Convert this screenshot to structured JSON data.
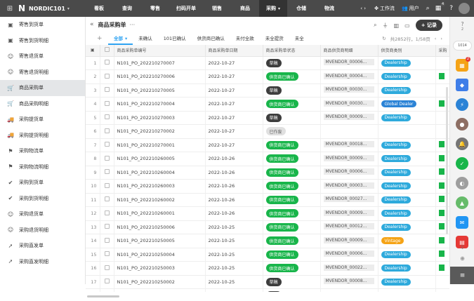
{
  "app": {
    "logo": "N",
    "brand": "NORDIC101"
  },
  "menu": [
    {
      "label": "看板",
      "width": 40
    },
    {
      "label": "查询",
      "width": 40
    },
    {
      "label": "零售",
      "width": 40
    },
    {
      "label": "扫码开单",
      "width": 48
    },
    {
      "label": "销售",
      "width": 40
    },
    {
      "label": "商品",
      "width": 40
    },
    {
      "label": "采购",
      "width": 40,
      "active": true,
      "caret": "▾"
    },
    {
      "label": "仓储",
      "width": 40
    },
    {
      "label": "物流",
      "width": 40
    }
  ],
  "topbar": {
    "nav_arrows": "‹ ›",
    "workflow": "工作流",
    "users": "用户",
    "notif_count": "4"
  },
  "sidebar": [
    {
      "icon": "▣",
      "label": "寄售到货单"
    },
    {
      "icon": "▣",
      "label": "寄售到货明细"
    },
    {
      "icon": "☺",
      "label": "寄售退货单"
    },
    {
      "icon": "☺",
      "label": "寄售退货明细"
    },
    {
      "icon": "🛒",
      "label": "商品采购单",
      "active": true
    },
    {
      "icon": "🛒",
      "label": "商品采购明细"
    },
    {
      "icon": "🚚",
      "label": "采购提货单"
    },
    {
      "icon": "🚚",
      "label": "采购提货明细"
    },
    {
      "icon": "⚑",
      "label": "采购物流单"
    },
    {
      "icon": "⚑",
      "label": "采购物流明细"
    },
    {
      "icon": "✔",
      "label": "采购到货单"
    },
    {
      "icon": "✔",
      "label": "采购到货明细"
    },
    {
      "icon": "☺",
      "label": "采购退货单"
    },
    {
      "icon": "☺",
      "label": "采购退货明细"
    },
    {
      "icon": "➚",
      "label": "采购直发单"
    },
    {
      "icon": "➚",
      "label": "采购直发明细"
    }
  ],
  "page": {
    "title": "商品采购单",
    "more": "···",
    "add_label": "+ 记录"
  },
  "tabs": [
    {
      "label": "全部",
      "active": true,
      "caret": "▾"
    },
    {
      "label": "未确认"
    },
    {
      "label": "101已确认"
    },
    {
      "label": "供货商已确认"
    },
    {
      "label": "未付全款"
    },
    {
      "label": "未全提货"
    },
    {
      "label": "未全"
    }
  ],
  "pagination": {
    "summary": "共2852行，1/58页"
  },
  "columns": [
    "商品采购单编号",
    "商品采购单日期",
    "商品采购单状态",
    "商品供货商明细",
    "供货商类别",
    "采购"
  ],
  "statuses": {
    "draft": "草稿",
    "confirmed": "供货商已确认",
    "void": "已作废"
  },
  "rows": [
    {
      "n": "1",
      "id": "N101_PO_202210270007",
      "date": "2022-10-27",
      "status": "draft",
      "vendor": "MVENDOR_00006...",
      "cat": "Dealership",
      "cat_type": "blue",
      "extra": false
    },
    {
      "n": "2",
      "id": "N101_PO_202210270006",
      "date": "2022-10-27",
      "status": "confirmed",
      "vendor": "MVENDOR_00004...",
      "cat": "Dealership",
      "cat_type": "blue",
      "extra": true
    },
    {
      "n": "3",
      "id": "N101_PO_202210270005",
      "date": "2022-10-27",
      "status": "draft",
      "vendor": "MVENDOR_00030...",
      "cat": "Dealership",
      "cat_type": "blue",
      "extra": false
    },
    {
      "n": "4",
      "id": "N101_PO_202210270004",
      "date": "2022-10-27",
      "status": "confirmed",
      "vendor": "MVENDOR_00030...",
      "cat": "Global Dealer",
      "cat_type": "gdel",
      "extra": true
    },
    {
      "n": "5",
      "id": "N101_PO_202210270003",
      "date": "2022-10-27",
      "status": "draft",
      "vendor": "MVENDOR_00009...",
      "cat": "Dealership",
      "cat_type": "blue",
      "extra": false
    },
    {
      "n": "6",
      "id": "N101_PO_202210270002",
      "date": "2022-10-27",
      "status": "void",
      "vendor": "",
      "cat": "",
      "cat_type": "",
      "extra": false
    },
    {
      "n": "7",
      "id": "N101_PO_202210270001",
      "date": "2022-10-27",
      "status": "confirmed",
      "vendor": "MVENDOR_00018...",
      "cat": "Dealership",
      "cat_type": "blue",
      "extra": true
    },
    {
      "n": "8",
      "id": "N101_PO_202210260005",
      "date": "2022-10-26",
      "status": "confirmed",
      "vendor": "MVENDOR_00009...",
      "cat": "Dealership",
      "cat_type": "blue",
      "extra": true
    },
    {
      "n": "9",
      "id": "N101_PO_202210260004",
      "date": "2022-10-26",
      "status": "confirmed",
      "vendor": "MVENDOR_00006...",
      "cat": "Dealership",
      "cat_type": "blue",
      "extra": true
    },
    {
      "n": "10",
      "id": "N101_PO_202210260003",
      "date": "2022-10-26",
      "status": "confirmed",
      "vendor": "MVENDOR_00003...",
      "cat": "Dealership",
      "cat_type": "blue",
      "extra": true
    },
    {
      "n": "11",
      "id": "N101_PO_202210260002",
      "date": "2022-10-26",
      "status": "confirmed",
      "vendor": "MVENDOR_00027...",
      "cat": "Dealership",
      "cat_type": "blue",
      "extra": true
    },
    {
      "n": "12",
      "id": "N101_PO_202210260001",
      "date": "2022-10-26",
      "status": "confirmed",
      "vendor": "MVENDOR_00009...",
      "cat": "Dealership",
      "cat_type": "blue",
      "extra": true
    },
    {
      "n": "13",
      "id": "N101_PO_202210250006",
      "date": "2022-10-25",
      "status": "confirmed",
      "vendor": "MVENDOR_00012...",
      "cat": "Dealership",
      "cat_type": "blue",
      "extra": true
    },
    {
      "n": "14",
      "id": "N101_PO_202210250005",
      "date": "2022-10-25",
      "status": "confirmed",
      "vendor": "MVENDOR_00009...",
      "cat": "Vintage",
      "cat_type": "vint",
      "extra": true
    },
    {
      "n": "15",
      "id": "N101_PO_202210250004",
      "date": "2022-10-25",
      "status": "confirmed",
      "vendor": "MVENDOR_00006...",
      "cat": "Dealership",
      "cat_type": "blue",
      "extra": true
    },
    {
      "n": "16",
      "id": "N101_PO_202210250003",
      "date": "2022-10-25",
      "status": "confirmed",
      "vendor": "MVENDOR_00022...",
      "cat": "Dealership",
      "cat_type": "blue",
      "extra": true
    },
    {
      "n": "17",
      "id": "N101_PO_202210250002",
      "date": "2022-10-25",
      "status": "draft",
      "vendor": "MVENDOR_00008...",
      "cat": "Dealership",
      "cat_type": "blue",
      "extra": false
    },
    {
      "n": "18",
      "id": "N101_PO_202210250001",
      "date": "2022-10-25",
      "status": "draft",
      "vendor": "MVENDOR_00007...",
      "cat": "Dealership",
      "cat_type": "blue",
      "extra": false
    }
  ],
  "rightbar": {
    "help_count": "2",
    "label_1014": "1014",
    "red_badge": "2"
  },
  "colors": {
    "topbar": "#4a4a4a",
    "accent": "#2ea3f2",
    "green": "#18b54a",
    "draft": "#3d3d3d",
    "dealership": "#2eaadc"
  }
}
